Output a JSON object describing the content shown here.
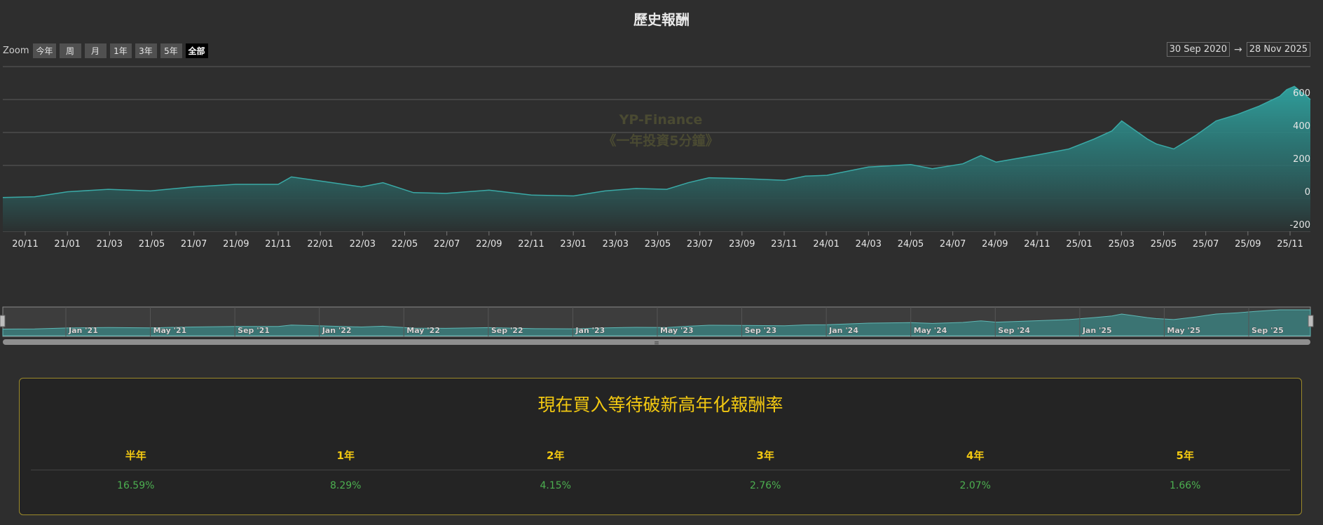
{
  "title": "歷史報酬",
  "zoom": {
    "label": "Zoom",
    "buttons": [
      "今年",
      "周",
      "月",
      "1年",
      "3年",
      "5年",
      "全部"
    ],
    "selected": "全部"
  },
  "date_range": {
    "from": "30 Sep 2020",
    "arrow": "→",
    "to": "28 Nov 2025"
  },
  "watermark": {
    "line1": "YP-Finance",
    "line2": "《一年投資5分鐘》"
  },
  "colors": {
    "line": "#3aa9a6",
    "fill_top": "#2f9e9b",
    "fill_bottom": "#2b3030",
    "accent": "#f2c811",
    "positive": "#4caf50"
  },
  "chart_data": {
    "type": "area",
    "title": "歷史報酬",
    "x_start": "2020-09-30",
    "x_end": "2025-11-28",
    "x_tick_labels": [
      "20/11",
      "21/01",
      "21/03",
      "21/05",
      "21/07",
      "21/09",
      "21/11",
      "22/01",
      "22/03",
      "22/05",
      "22/07",
      "22/09",
      "22/11",
      "23/01",
      "23/03",
      "23/05",
      "23/07",
      "23/09",
      "23/11",
      "24/01",
      "24/03",
      "24/05",
      "24/07",
      "24/09",
      "24/11",
      "25/01",
      "25/03",
      "25/05",
      "25/07",
      "25/09",
      "25/11"
    ],
    "y_ticks": [
      -200,
      0,
      200,
      400,
      600
    ],
    "ylim": [
      -200,
      800
    ],
    "grid": true,
    "x": [
      "2020-09-30",
      "2020-11-15",
      "2021-01-01",
      "2021-03-01",
      "2021-05-01",
      "2021-07-01",
      "2021-09-01",
      "2021-11-01",
      "2021-11-20",
      "2022-01-01",
      "2022-03-01",
      "2022-04-01",
      "2022-05-15",
      "2022-07-01",
      "2022-09-01",
      "2022-11-01",
      "2023-01-01",
      "2023-02-15",
      "2023-04-01",
      "2023-05-15",
      "2023-06-15",
      "2023-07-15",
      "2023-09-01",
      "2023-11-01",
      "2023-12-01",
      "2024-01-01",
      "2024-03-01",
      "2024-05-01",
      "2024-06-01",
      "2024-07-15",
      "2024-08-10",
      "2024-09-01",
      "2024-11-01",
      "2024-12-15",
      "2025-01-20",
      "2025-02-15",
      "2025-03-01",
      "2025-04-07",
      "2025-04-20",
      "2025-05-15",
      "2025-06-15",
      "2025-07-15",
      "2025-08-15",
      "2025-09-15",
      "2025-10-15",
      "2025-10-25",
      "2025-11-05",
      "2025-11-28"
    ],
    "series": [
      {
        "values": [
          5,
          10,
          40,
          55,
          45,
          70,
          85,
          85,
          130,
          105,
          70,
          95,
          35,
          30,
          50,
          20,
          15,
          45,
          60,
          55,
          95,
          125,
          120,
          110,
          135,
          140,
          190,
          205,
          180,
          210,
          260,
          220,
          265,
          300,
          360,
          410,
          470,
          360,
          330,
          300,
          380,
          470,
          510,
          560,
          620,
          660,
          680,
          600
        ]
      }
    ]
  },
  "navigator": {
    "labels": [
      "Jan '21",
      "May '21",
      "Sep '21",
      "Jan '22",
      "May '22",
      "Sep '22",
      "Jan '23",
      "May '23",
      "Sep '23",
      "Jan '24",
      "May '24",
      "Sep '24",
      "Jan '25",
      "May '25",
      "Sep '25"
    ],
    "scroll_grip": "≡"
  },
  "panel": {
    "title": "現在買入等待破新高年化報酬率",
    "headers": [
      "半年",
      "1年",
      "2年",
      "3年",
      "4年",
      "5年"
    ],
    "values": [
      "16.59%",
      "8.29%",
      "4.15%",
      "2.76%",
      "2.07%",
      "1.66%"
    ]
  }
}
